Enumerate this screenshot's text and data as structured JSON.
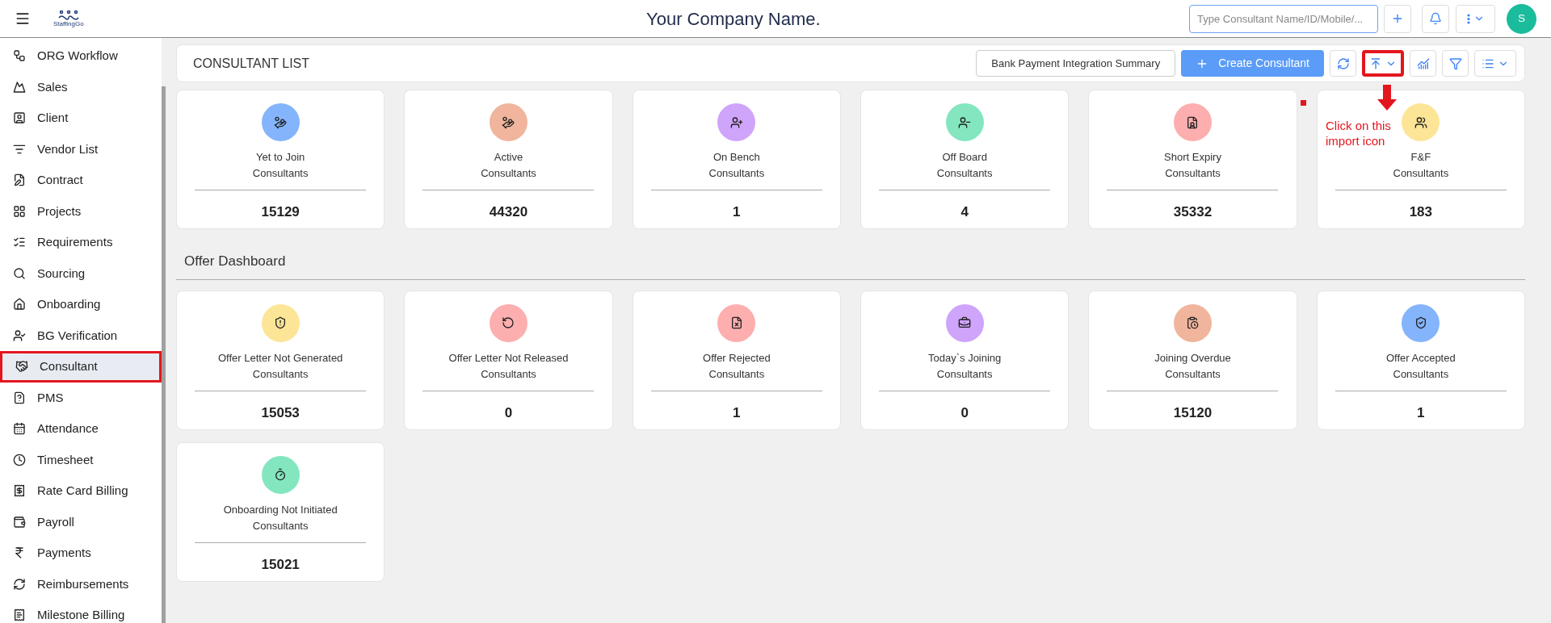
{
  "header": {
    "logo_text": "StaffingGo",
    "company": "Your Company Name.",
    "search": {
      "placeholder": "Type Consultant Name/ID/Mobile/..."
    },
    "avatar": "S"
  },
  "sidebar": {
    "items": [
      {
        "label": "ORG Workflow",
        "selected": false,
        "highlighted": false
      },
      {
        "label": "Sales",
        "selected": false,
        "highlighted": false
      },
      {
        "label": "Client",
        "selected": false,
        "highlighted": false
      },
      {
        "label": "Vendor List",
        "selected": false,
        "highlighted": false
      },
      {
        "label": "Contract",
        "selected": false,
        "highlighted": false
      },
      {
        "label": "Projects",
        "selected": false,
        "highlighted": false
      },
      {
        "label": "Requirements",
        "selected": false,
        "highlighted": false
      },
      {
        "label": "Sourcing",
        "selected": false,
        "highlighted": false
      },
      {
        "label": "Onboarding",
        "selected": false,
        "highlighted": false
      },
      {
        "label": "BG Verification",
        "selected": false,
        "highlighted": false
      },
      {
        "label": "Consultant",
        "selected": true,
        "highlighted": true
      },
      {
        "label": "PMS",
        "selected": false,
        "highlighted": false
      },
      {
        "label": "Attendance",
        "selected": false,
        "highlighted": false
      },
      {
        "label": "Timesheet",
        "selected": false,
        "highlighted": false
      },
      {
        "label": "Rate Card Billing",
        "selected": false,
        "highlighted": false
      },
      {
        "label": "Payroll",
        "selected": false,
        "highlighted": false
      },
      {
        "label": "Payments",
        "selected": false,
        "highlighted": false
      },
      {
        "label": "Reimbursements",
        "selected": false,
        "highlighted": false
      },
      {
        "label": "Milestone Billing",
        "selected": false,
        "highlighted": false
      }
    ]
  },
  "toolbar": {
    "title": "CONSULTANT LIST",
    "summary_button": "Bank Payment Integration Summary",
    "create_button": "Create Consultant",
    "icon_buttons": [
      {
        "kind": "refresh",
        "highlighted": false
      },
      {
        "kind": "import",
        "highlighted": true
      },
      {
        "kind": "chart",
        "highlighted": false
      },
      {
        "kind": "filter",
        "highlighted": false
      },
      {
        "kind": "list",
        "highlighted": false
      }
    ]
  },
  "annotation": {
    "text": "Click on this import icon"
  },
  "consultant_cards": [
    {
      "title": "Yet to Join",
      "subtitle": "Consultants",
      "count": "15129",
      "color": "#84b4fb"
    },
    {
      "title": "Active",
      "subtitle": "Consultants",
      "count": "44320",
      "color": "#f0b59c"
    },
    {
      "title": "On Bench",
      "subtitle": "Consultants",
      "count": "1",
      "color": "#cfa4fb"
    },
    {
      "title": "Off Board",
      "subtitle": "Consultants",
      "count": "4",
      "color": "#83e6bf"
    },
    {
      "title": "Short Expiry",
      "subtitle": "Consultants",
      "count": "35332",
      "color": "#fdaeae"
    },
    {
      "title": "F&F",
      "subtitle": "Consultants",
      "count": "183",
      "color": "#fde597"
    }
  ],
  "offer_dashboard": {
    "title": "Offer Dashboard",
    "cards": [
      {
        "title": "Offer Letter Not Generated",
        "subtitle": "Consultants",
        "count": "15053",
        "color": "#fde597"
      },
      {
        "title": "Offer Letter Not Released",
        "subtitle": "Consultants",
        "count": "0",
        "color": "#fdaeae"
      },
      {
        "title": "Offer Rejected",
        "subtitle": "Consultants",
        "count": "1",
        "color": "#fdaeae"
      },
      {
        "title": "Today`s Joining",
        "subtitle": "Consultants",
        "count": "0",
        "color": "#cfa4fb"
      },
      {
        "title": "Joining Overdue",
        "subtitle": "Consultants",
        "count": "15120",
        "color": "#f0b59c"
      },
      {
        "title": "Offer Accepted",
        "subtitle": "Consultants",
        "count": "1",
        "color": "#84b4fb"
      },
      {
        "title": "Onboarding Not Initiated",
        "subtitle": "Consultants",
        "count": "15021",
        "color": "#83e6bf"
      }
    ]
  }
}
